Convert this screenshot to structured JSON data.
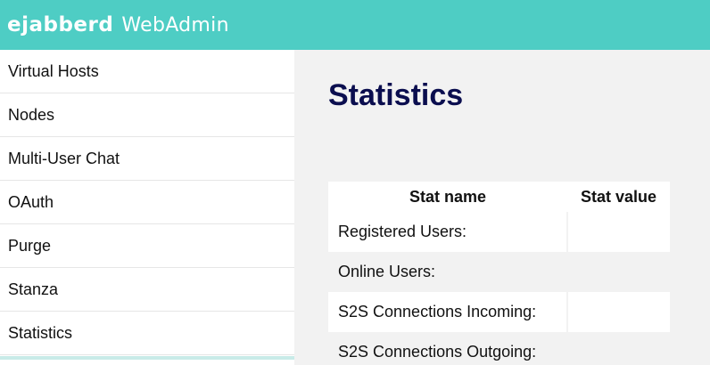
{
  "header": {
    "brand": "ejabberd",
    "product": "WebAdmin"
  },
  "sidebar": {
    "items": [
      {
        "label": "Virtual Hosts"
      },
      {
        "label": "Nodes"
      },
      {
        "label": "Multi-User Chat"
      },
      {
        "label": "OAuth"
      },
      {
        "label": "Purge"
      },
      {
        "label": "Stanza"
      },
      {
        "label": "Statistics"
      }
    ]
  },
  "main": {
    "title": "Statistics",
    "table": {
      "headers": [
        "Stat name",
        "Stat value"
      ],
      "rows": [
        {
          "name": "Registered Users:",
          "value": ""
        },
        {
          "name": "Online Users:",
          "value": ""
        },
        {
          "name": "S2S Connections Incoming:",
          "value": ""
        },
        {
          "name": "S2S Connections Outgoing:",
          "value": ""
        }
      ]
    }
  },
  "colors": {
    "header_bg": "#4ecdc4",
    "title": "#0b0e4f",
    "page_bg": "#f2f2f2"
  }
}
